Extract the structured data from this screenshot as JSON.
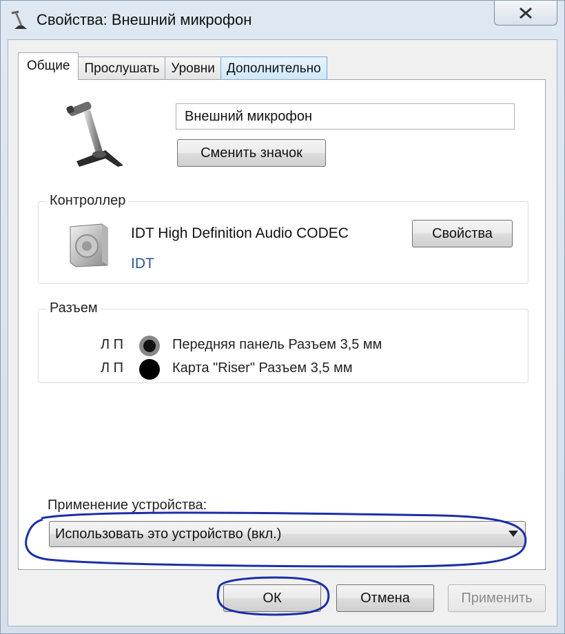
{
  "window": {
    "title": "Свойства: Внешний микрофон"
  },
  "tabs": [
    {
      "label": "Общие"
    },
    {
      "label": "Прослушать"
    },
    {
      "label": "Уровни"
    },
    {
      "label": "Дополнительно"
    }
  ],
  "device": {
    "name": "Внешний микрофон",
    "change_icon_label": "Сменить значок"
  },
  "controller": {
    "group_label": "Контроллер",
    "name": "IDT High Definition Audio CODEC",
    "vendor": "IDT",
    "properties_label": "Свойства"
  },
  "jack": {
    "group_label": "Разъем",
    "rows": [
      {
        "channels": "Л П",
        "label": "Передняя панель Разъем 3,5 мм"
      },
      {
        "channels": "Л П",
        "label": "Карта \"Riser\" Разъем 3,5 мм"
      }
    ]
  },
  "usage": {
    "label": "Применение устройства:",
    "value": "Использовать это устройство (вкл.)"
  },
  "buttons": {
    "ok": "ОК",
    "cancel": "Отмена",
    "apply": "Применить"
  },
  "colors": {
    "annotation": "#1a2ea8",
    "link_text": "#2a5599",
    "tab_highlight": "#cde7f8"
  },
  "icons": {
    "title": "microphone-icon",
    "close": "close-icon",
    "device": "microphone-icon",
    "controller": "speaker-icon",
    "dropdown": "chevron-down-icon"
  }
}
